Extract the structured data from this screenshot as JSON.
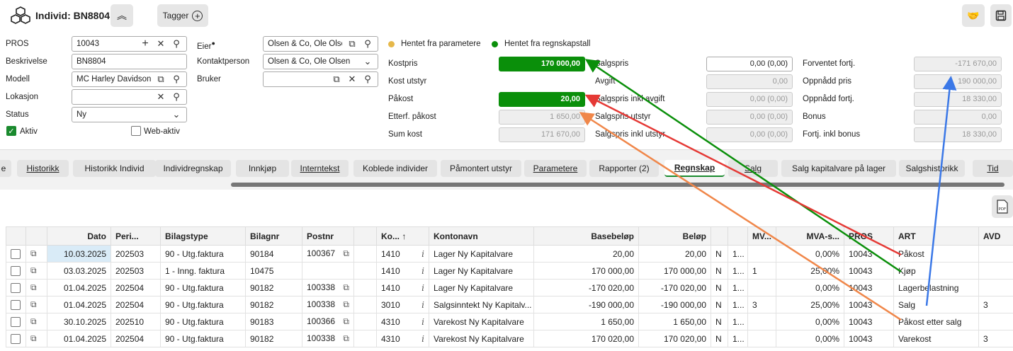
{
  "header": {
    "title": "Individ: BN8804",
    "tagger_label": "Tagger"
  },
  "form": {
    "pros_label": "PROS",
    "pros_value": "10043",
    "beskrivelse_label": "Beskrivelse",
    "beskrivelse_value": "BN8804",
    "modell_label": "Modell",
    "modell_value": "MC Harley Davidson Sport",
    "lokasjon_label": "Lokasjon",
    "lokasjon_value": "",
    "status_label": "Status",
    "status_value": "Ny",
    "aktiv_label": "Aktiv",
    "webaktiv_label": "Web-aktiv",
    "eier_label": "Eier",
    "eier_value": "Olsen  & Co, Ole Olsen",
    "kontakt_label": "Kontaktperson",
    "kontakt_value": "Olsen & Co, Ole Olsen",
    "bruker_label": "Bruker",
    "bruker_value": ""
  },
  "legend": {
    "param_label": "Hentet fra parametere",
    "param_color": "#e6b84a",
    "regn_label": "Hentet fra regnskapstall",
    "regn_color": "#0a8f0a"
  },
  "kost": {
    "kostpris_label": "Kostpris",
    "kostpris": "170 000,00",
    "kostutstyr_label": "Kost utstyr",
    "kostutstyr": "",
    "pakost_label": "Påkost",
    "pakost": "20,00",
    "etterf_label": "Etterf. påkost",
    "etterf": "1 650,00",
    "sumkost_label": "Sum kost",
    "sumkost": "171 670,00"
  },
  "salg": {
    "salgspris_label": "Salgspris",
    "salgspris": "0,00 (0,00)",
    "avgift_label": "Avgift",
    "avgift": "0,00",
    "inkl_label": "Salgspris inkl avgift",
    "inkl": "0,00 (0,00)",
    "utstyr_label": "Salgspris utstyr",
    "utstyr": "0,00 (0,00)",
    "inklutstyr_label": "Salgspris inkl utstyr",
    "inklutstyr": "0,00 (0,00)"
  },
  "fortj": {
    "forventet_label": "Forventet fortj.",
    "forventet": "-171 670,00",
    "oppnaddpris_label": "Oppnådd pris",
    "oppnaddpris": "190 000,00",
    "oppnaddfortj_label": "Oppnådd fortj.",
    "oppnaddfortj": "18 330,00",
    "bonus_label": "Bonus",
    "bonus": "0,00",
    "inklbonus_label": "Fortj. inkl bonus",
    "inklbonus": "18 330,00"
  },
  "tabs": [
    "e",
    "Historikk",
    "Historikk Individ",
    "Individregnskap",
    "Innkjøp",
    "Internteks",
    "Koblede individer",
    "Påmontert utstyr",
    "Parametere",
    "Rapporter (2)",
    "Regnskap",
    "Salg",
    "Salg kapitalvare på lager",
    "Salgshistorikk",
    "Tid"
  ],
  "tabs_t": "Internteks",
  "tab_internt": "Interntekst",
  "table": {
    "headers": [
      "Dato",
      "Peri...",
      "Bilagstype",
      "Bilagnr",
      "Postnr",
      "Ko...",
      "Kontonavn",
      "Basebeløp",
      "Beløp",
      "MV...",
      "MVA-s...",
      "PROS",
      "ART",
      "AVD"
    ],
    "rows": [
      [
        "10.03.2025",
        "202503",
        "90 - Utg.faktura",
        "90184",
        "100367",
        "1410",
        "Lager Ny Kapitalvare",
        "20,00",
        "20,00",
        "N",
        "1...",
        "",
        "0,00%",
        "10043",
        "Påkost",
        ""
      ],
      [
        "03.03.2025",
        "202503",
        "1 - Inng. faktura",
        "10475",
        "",
        "1410",
        "Lager Ny Kapitalvare",
        "170 000,00",
        "170 000,00",
        "N",
        "1...",
        "1",
        "25,00%",
        "10043",
        "Kjøp",
        ""
      ],
      [
        "01.04.2025",
        "202504",
        "90 - Utg.faktura",
        "90182",
        "100338",
        "1410",
        "Lager Ny Kapitalvare",
        "-170 020,00",
        "-170 020,00",
        "N",
        "1...",
        "",
        "0,00%",
        "10043",
        "Lagerbelastning",
        ""
      ],
      [
        "01.04.2025",
        "202504",
        "90 - Utg.faktura",
        "90182",
        "100338",
        "3010",
        "Salgsinntekt Ny Kapitalv...",
        "-190 000,00",
        "-190 000,00",
        "N",
        "1...",
        "3",
        "25,00%",
        "10043",
        "Salg",
        "3"
      ],
      [
        "30.10.2025",
        "202510",
        "90 - Utg.faktura",
        "90183",
        "100366",
        "4310",
        "Varekost Ny Kapitalvare",
        "1 650,00",
        "1 650,00",
        "N",
        "1...",
        "",
        "0,00%",
        "10043",
        "Påkost etter salg",
        ""
      ],
      [
        "01.04.2025",
        "202504",
        "90 - Utg.faktura",
        "90182",
        "100338",
        "4310",
        "Varekost Ny Kapitalvare",
        "170 020,00",
        "170 020,00",
        "N",
        "1...",
        "",
        "0,00%",
        "10043",
        "Varekost",
        "3"
      ]
    ]
  },
  "colors": {
    "green": "#0a8f0a",
    "red": "#e53935",
    "orange": "#f0874a",
    "blue": "#3b78e7"
  }
}
